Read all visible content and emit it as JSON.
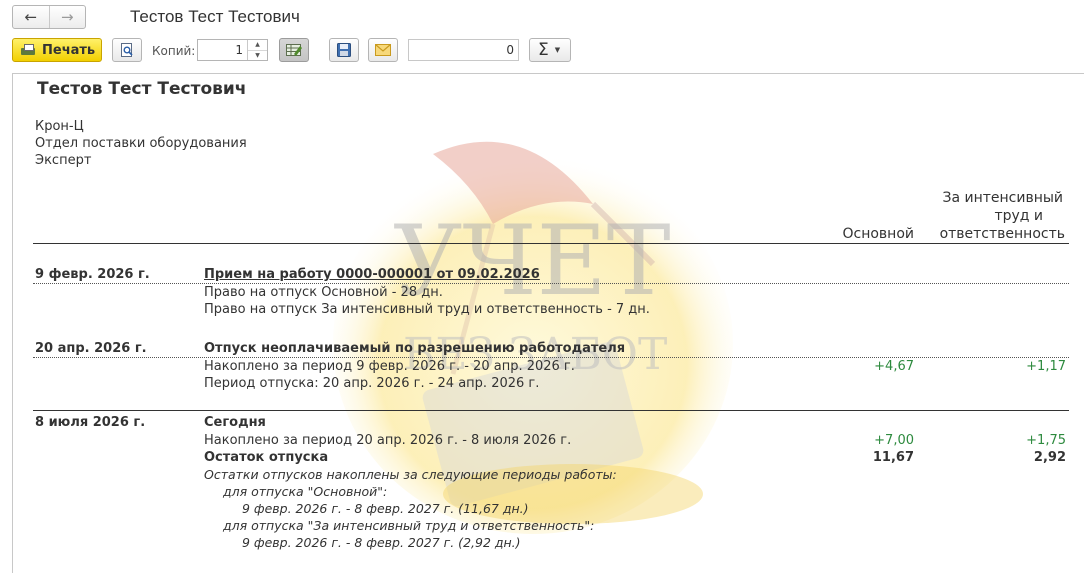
{
  "window": {
    "title": "Тестов Тест Тестович"
  },
  "nav": {
    "back_icon": "←",
    "forward_icon": "→"
  },
  "toolbar": {
    "print_label": "Печать",
    "copies_label": "Копий:",
    "copies_value": "1",
    "sum_value": "0",
    "sigma_symbol": "Σ",
    "sigma_caret": "▼",
    "spin_up": "▲",
    "spin_down": "▼"
  },
  "colors": {
    "accent_yellow": "#f5d400",
    "positive_green": "#2d8a3e",
    "text": "#333333"
  },
  "report": {
    "employee": "Тестов Тест Тестович",
    "org": "Крон-Ц",
    "department": "Отдел поставки оборудования",
    "position": "Эксперт",
    "col_headers": {
      "intensive_line1": "За интенсивный",
      "intensive_line2": "труд и",
      "basic": "Основной",
      "intensive_line3": "ответственность"
    },
    "events": [
      {
        "date": "9 февр. 2026 г.",
        "title": "Прием на работу 0000-000001 от 09.02.2026",
        "lines": [
          "Право на отпуск Основной - 28 дн.",
          "Право на отпуск За интенсивный труд и ответственность - 7 дн."
        ]
      },
      {
        "date": "20 апр. 2026 г.",
        "title": "Отпуск неоплачиваемый по разрешению работодателя",
        "lines": [
          "Накоплено за период 9 февр. 2026 г. - 20 апр. 2026 г.",
          "Период отпуска: 20 апр. 2026 г. - 24 апр. 2026 г."
        ],
        "accrued_basic": "+4,67",
        "accrued_intensive": "+1,17"
      },
      {
        "date": "8 июля 2026 г.",
        "title": "Сегодня",
        "lines": [
          "Накоплено за период 20 апр. 2026 г. - 8 июля 2026 г."
        ],
        "accrued_basic": "+7,00",
        "accrued_intensive": "+1,75",
        "balance_label": "Остаток отпуска",
        "balance_basic": "11,67",
        "balance_intensive": "2,92",
        "notes": [
          "Остатки отпусков накоплены за следующие периоды работы:",
          "для отпуска \"Основной\":",
          "9 февр. 2026 г. - 8 февр. 2027 г. (11,67 дн.)",
          "для отпуска \"За интенсивный труд и ответственность\":",
          "9 февр. 2026 г. - 8 февр. 2027 г. (2,92 дн.)"
        ]
      }
    ]
  },
  "watermark": {
    "line1": "УЧЕТ",
    "line2": "БЕЗ ЗАБОТ"
  }
}
